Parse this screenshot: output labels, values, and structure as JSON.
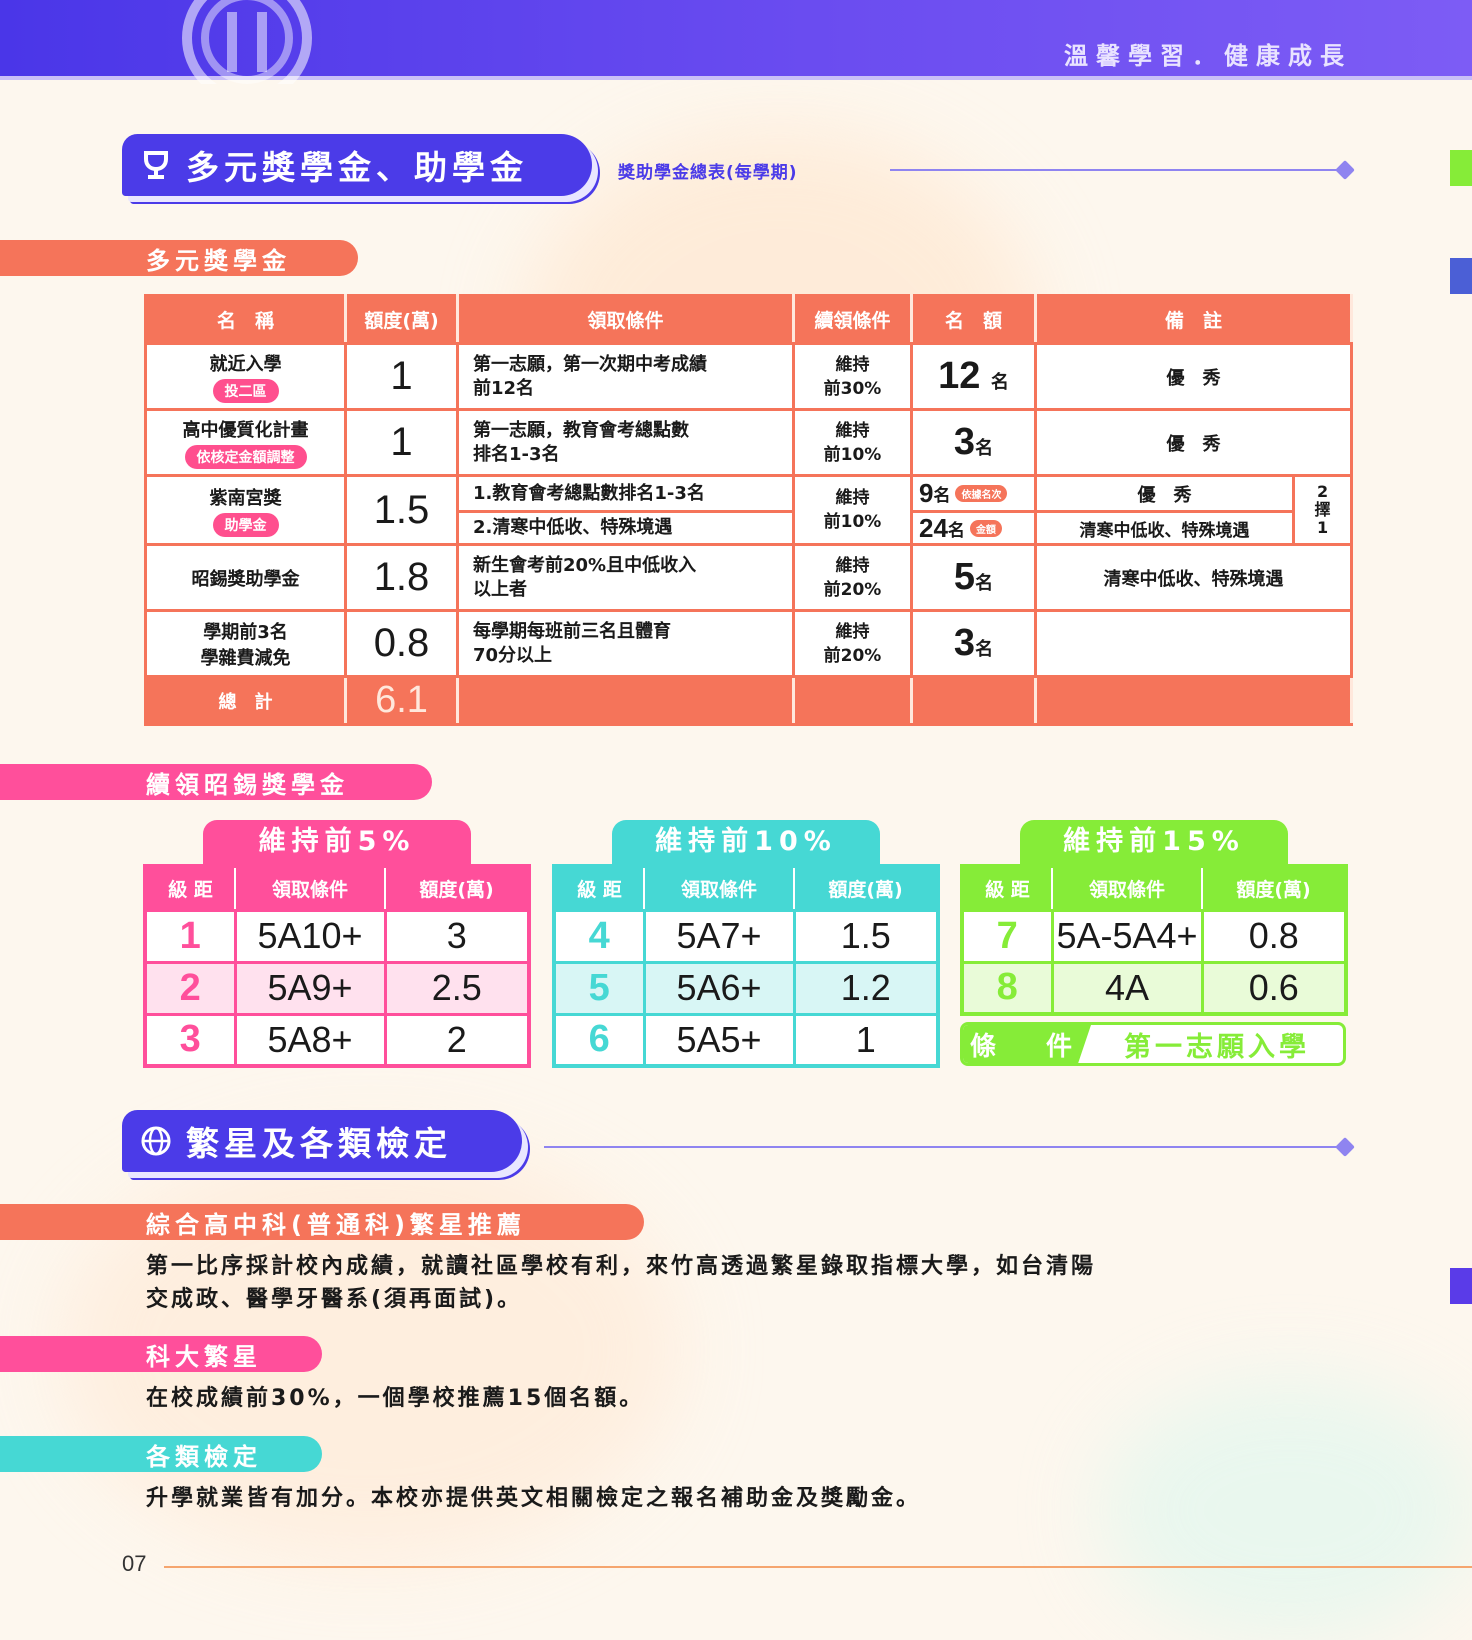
{
  "header": {
    "slogan": "溫馨學習．健康成長"
  },
  "section1": {
    "title": "多元獎學金、助學金",
    "caption": "獎助學金總表(每學期)"
  },
  "scholarship": {
    "heading": "多元獎學金",
    "columns": [
      "名　稱",
      "額度(萬)",
      "領取條件",
      "續領條件",
      "名　額",
      "備　註"
    ],
    "rows": [
      {
        "name": "就近入學",
        "tag": "投二區",
        "amount": "1",
        "cond": [
          "第一志願，第一次期中考成績",
          "前12名"
        ],
        "keep": [
          "維持",
          "前30%"
        ],
        "quota": "12",
        "quota_unit": "名",
        "note": "優　秀"
      },
      {
        "name": "高中優質化計畫",
        "tag": "依核定金額調整",
        "amount": "1",
        "cond": [
          "第一志願，教育會考總點數",
          "排名1-3名"
        ],
        "keep": [
          "維持",
          "前10%"
        ],
        "quota": "3",
        "quota_unit": "名",
        "note": "優　秀"
      },
      {
        "name": "紫南宮獎",
        "tag": "助學金",
        "amount": "1.5",
        "cond_a": "1.教育會考總點數排名1-3名",
        "cond_b": "2.清寒中低收、特殊境遇",
        "keep": [
          "維持",
          "前10%"
        ],
        "quota_a": "9",
        "quota_a_unit": "名",
        "quota_a_tag": "依據名次",
        "quota_b": "24",
        "quota_b_unit": "名",
        "quota_b_tag": "金額",
        "note_a": "優　秀",
        "note_b": "清寒中低收、特殊境遇",
        "choice": [
          "2",
          "擇",
          "1"
        ]
      },
      {
        "name": "昭錫獎助學金",
        "amount": "1.8",
        "cond": [
          "新生會考前20%且中低收入",
          "以上者"
        ],
        "keep": [
          "維持",
          "前20%"
        ],
        "quota": "5",
        "quota_unit": "名",
        "note": "清寒中低收、特殊境遇"
      },
      {
        "name": [
          "學期前3名",
          "學雜費減免"
        ],
        "amount": "0.8",
        "cond": [
          "每學期每班前三名且體育",
          "70分以上"
        ],
        "keep": [
          "維持",
          "前20%"
        ],
        "quota": "3",
        "quota_unit": "名",
        "note": ""
      }
    ],
    "total_label": "總　計",
    "total_amount": "6.1"
  },
  "continuation": {
    "heading": "續領昭錫獎學金",
    "columns": [
      "級 距",
      "領取條件",
      "額度(萬)"
    ],
    "groups": [
      {
        "title": "維持前5%",
        "color": "#ff4f9b",
        "rows": [
          [
            "1",
            "5A10+",
            "3"
          ],
          [
            "2",
            "5A9+",
            "2.5"
          ],
          [
            "3",
            "5A8+",
            "2"
          ]
        ]
      },
      {
        "title": "維持前10%",
        "color": "#46d8d4",
        "rows": [
          [
            "4",
            "5A7+",
            "1.5"
          ],
          [
            "5",
            "5A6+",
            "1.2"
          ],
          [
            "6",
            "5A5+",
            "1"
          ]
        ]
      },
      {
        "title": "維持前15%",
        "color": "#86ec38",
        "rows": [
          [
            "7",
            "5A-5A4+",
            "0.8"
          ],
          [
            "8",
            "4A",
            "0.6"
          ]
        ]
      }
    ],
    "condition_label": "條　件",
    "condition_value": "第一志願入學"
  },
  "section2": {
    "title": "繁星及各類檢定",
    "items": [
      {
        "heading": "綜合高中科(普通科)繁星推薦",
        "color": "#f5745a",
        "text": [
          "第一比序採計校內成績，就讀社區學校有利，來竹高透過繁星錄取指標大學，如台清陽",
          "交成政、醫學牙醫系(須再面試)。"
        ]
      },
      {
        "heading": "科大繁星",
        "color": "#ff4f9b",
        "text": [
          "在校成績前30%，一個學校推薦15個名額。"
        ]
      },
      {
        "heading": "各類檢定",
        "color": "#46d8d4",
        "text": [
          "升學就業皆有加分。本校亦提供英文相關檢定之報名補助金及獎勵金。"
        ]
      }
    ]
  },
  "footer": {
    "page": "07"
  },
  "colors": {
    "brand": "#4b3be8",
    "coral": "#f5745a",
    "pink": "#ff4f9b",
    "teal": "#46d8d4",
    "green": "#86ec38"
  }
}
